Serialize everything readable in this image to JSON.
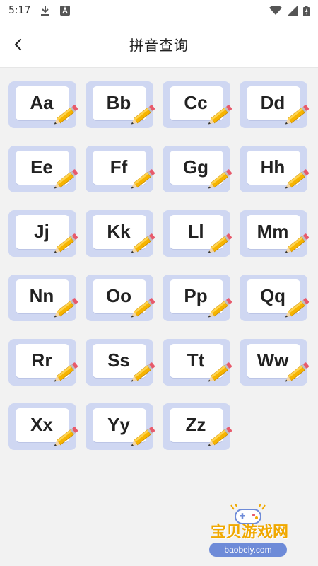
{
  "statusbar": {
    "time": "5:17",
    "icons": [
      "download-icon",
      "a-icon",
      "wifi-icon",
      "signal-icon",
      "battery-icon"
    ]
  },
  "header": {
    "back_icon": "chevron-left-icon",
    "title": "拼音查询"
  },
  "letters": [
    "Aa",
    "Bb",
    "Cc",
    "Dd",
    "Ee",
    "Ff",
    "Gg",
    "Hh",
    "Jj",
    "Kk",
    "Ll",
    "Mm",
    "Nn",
    "Oo",
    "Pp",
    "Qq",
    "Rr",
    "Ss",
    "Tt",
    "Ww",
    "Xx",
    "Yy",
    "Zz"
  ],
  "watermark": {
    "text": "宝贝游戏网",
    "url": "baobeiy.com"
  },
  "colors": {
    "card_base": "#cfd7f2",
    "paper": "#ffffff",
    "pencil_body": "#f6b400",
    "pencil_eraser": "#e85a6b",
    "background": "#f2f2f2",
    "watermark_text": "#f0a800",
    "watermark_url_bg": "#6e8bd8"
  }
}
